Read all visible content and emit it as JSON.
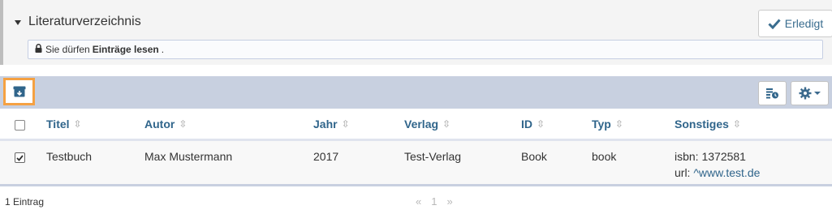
{
  "panel": {
    "title": "Literaturverzeichnis",
    "done_label": "Erledigt",
    "permission": {
      "prefix": "Sie dürfen",
      "bold": "Einträge lesen",
      "suffix": "."
    }
  },
  "toolbar": {
    "export_icon": "archive-download-icon",
    "columns_icon": "table-columns-icon",
    "settings_icon": "gear-icon"
  },
  "table": {
    "columns": [
      "Titel",
      "Autor",
      "Jahr",
      "Verlag",
      "ID",
      "Typ",
      "Sonstiges"
    ],
    "rows": [
      {
        "checked": true,
        "titel": "Testbuch",
        "autor": "Max Mustermann",
        "jahr": "2017",
        "verlag": "Test-Verlag",
        "id": "Book",
        "typ": "book",
        "sonstiges_line1": "isbn: 1372581",
        "sonstiges_line2_prefix": "url: ",
        "sonstiges_link": "^www.test.de"
      }
    ]
  },
  "footer": {
    "count": "1 Eintrag",
    "pager": {
      "prev": "«",
      "page": "1",
      "next": "»"
    }
  },
  "colors": {
    "accent": "#30658b",
    "toolbar_bg": "#c8d0e0",
    "highlight": "#f5a142"
  }
}
